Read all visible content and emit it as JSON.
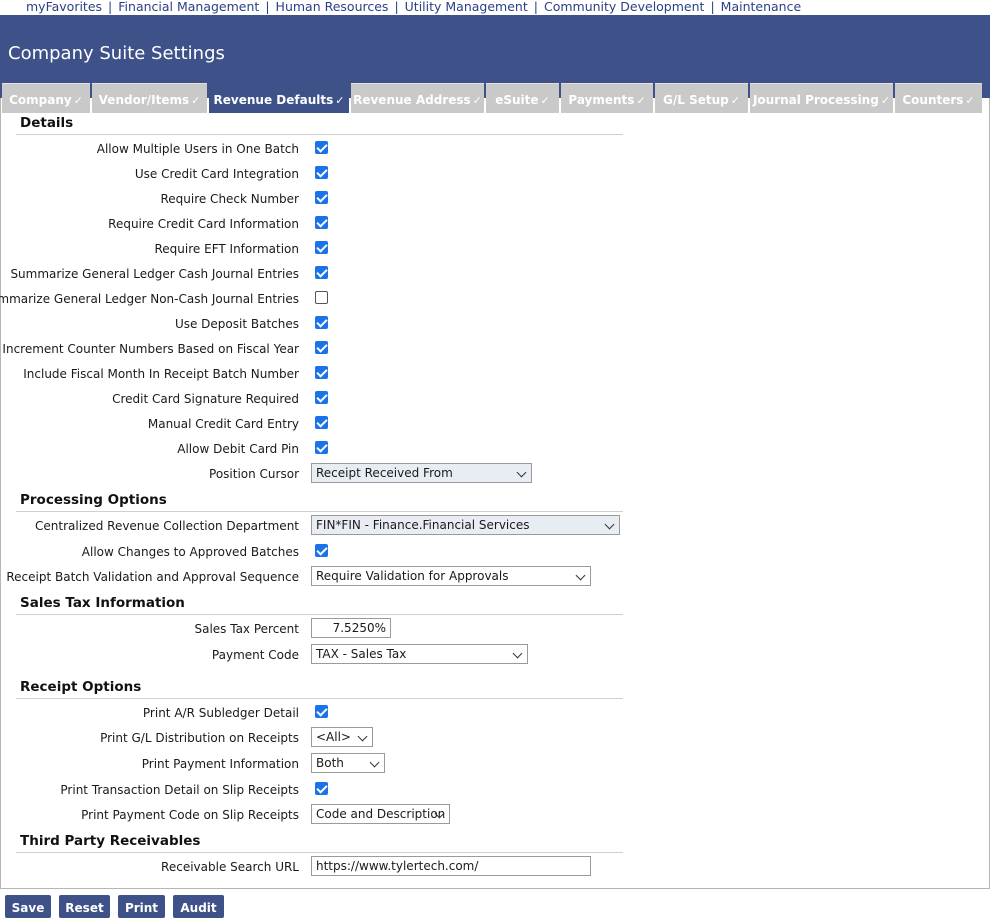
{
  "top_nav": [
    "myFavorites",
    "Financial Management",
    "Human Resources",
    "Utility Management",
    "Community Development",
    "Maintenance"
  ],
  "top_nav_separator": "|",
  "page_title": "Company Suite Settings",
  "tabs": [
    {
      "label": "Company",
      "active": false
    },
    {
      "label": "Vendor/Items",
      "active": false
    },
    {
      "label": "Revenue Defaults",
      "active": true
    },
    {
      "label": "Revenue Address",
      "active": false
    },
    {
      "label": "eSuite",
      "active": false
    },
    {
      "label": "Payments",
      "active": false
    },
    {
      "label": "G/L Setup",
      "active": false
    },
    {
      "label": "Journal Processing",
      "active": false
    },
    {
      "label": "Counters",
      "active": false
    }
  ],
  "details": {
    "heading": "Details",
    "fields": [
      {
        "label": "Allow Multiple Users in One Batch",
        "checked": true
      },
      {
        "label": "Use Credit Card Integration",
        "checked": true
      },
      {
        "label": "Require Check Number",
        "checked": true
      },
      {
        "label": "Require Credit Card Information",
        "checked": true
      },
      {
        "label": "Require EFT Information",
        "checked": true
      },
      {
        "label": "Summarize General Ledger Cash Journal Entries",
        "checked": true
      },
      {
        "label": "Summarize General Ledger Non-Cash Journal Entries",
        "checked": false
      },
      {
        "label": "Use Deposit Batches",
        "checked": true
      },
      {
        "label": "Increment Counter Numbers Based on Fiscal Year",
        "checked": true
      },
      {
        "label": "Include Fiscal Month In Receipt Batch Number",
        "checked": true
      },
      {
        "label": "Credit Card Signature Required",
        "checked": true
      },
      {
        "label": "Manual Credit Card Entry",
        "checked": true
      },
      {
        "label": "Allow Debit Card Pin",
        "checked": true
      }
    ],
    "position_cursor": {
      "label": "Position Cursor",
      "value": "Receipt Received From"
    }
  },
  "processing": {
    "heading": "Processing Options",
    "department": {
      "label": "Centralized Revenue Collection Department",
      "value": "FIN*FIN - Finance.Financial Services"
    },
    "allow_changes": {
      "label": "Allow Changes to Approved Batches",
      "checked": true
    },
    "sequence": {
      "label": "Receipt Batch Validation and Approval Sequence",
      "value": "Require Validation for Approvals"
    }
  },
  "sales_tax": {
    "heading": "Sales Tax Information",
    "percent": {
      "label": "Sales Tax Percent",
      "value": "7.5250%"
    },
    "payment_code": {
      "label": "Payment Code",
      "value": "TAX - Sales Tax"
    }
  },
  "receipt": {
    "heading": "Receipt Options",
    "ar_detail": {
      "label": "Print A/R Subledger Detail",
      "checked": true
    },
    "gl_dist": {
      "label": "Print G/L Distribution on Receipts",
      "value": "<All>"
    },
    "payment_info": {
      "label": "Print Payment Information",
      "value": "Both"
    },
    "txn_detail": {
      "label": "Print Transaction Detail on Slip Receipts",
      "checked": true
    },
    "payment_code": {
      "label": "Print Payment Code on Slip Receipts",
      "value": "Code and Description"
    }
  },
  "third_party": {
    "heading": "Third Party Receivables",
    "url": {
      "label": "Receivable Search URL",
      "value": "https://www.tylertech.com/"
    }
  },
  "buttons": {
    "save": "Save",
    "reset": "Reset",
    "print": "Print",
    "audit": "Audit"
  },
  "colors": {
    "header": "#3e5189",
    "tab_inactive": "#c9c9c9",
    "checkbox": "#1a73e8"
  }
}
